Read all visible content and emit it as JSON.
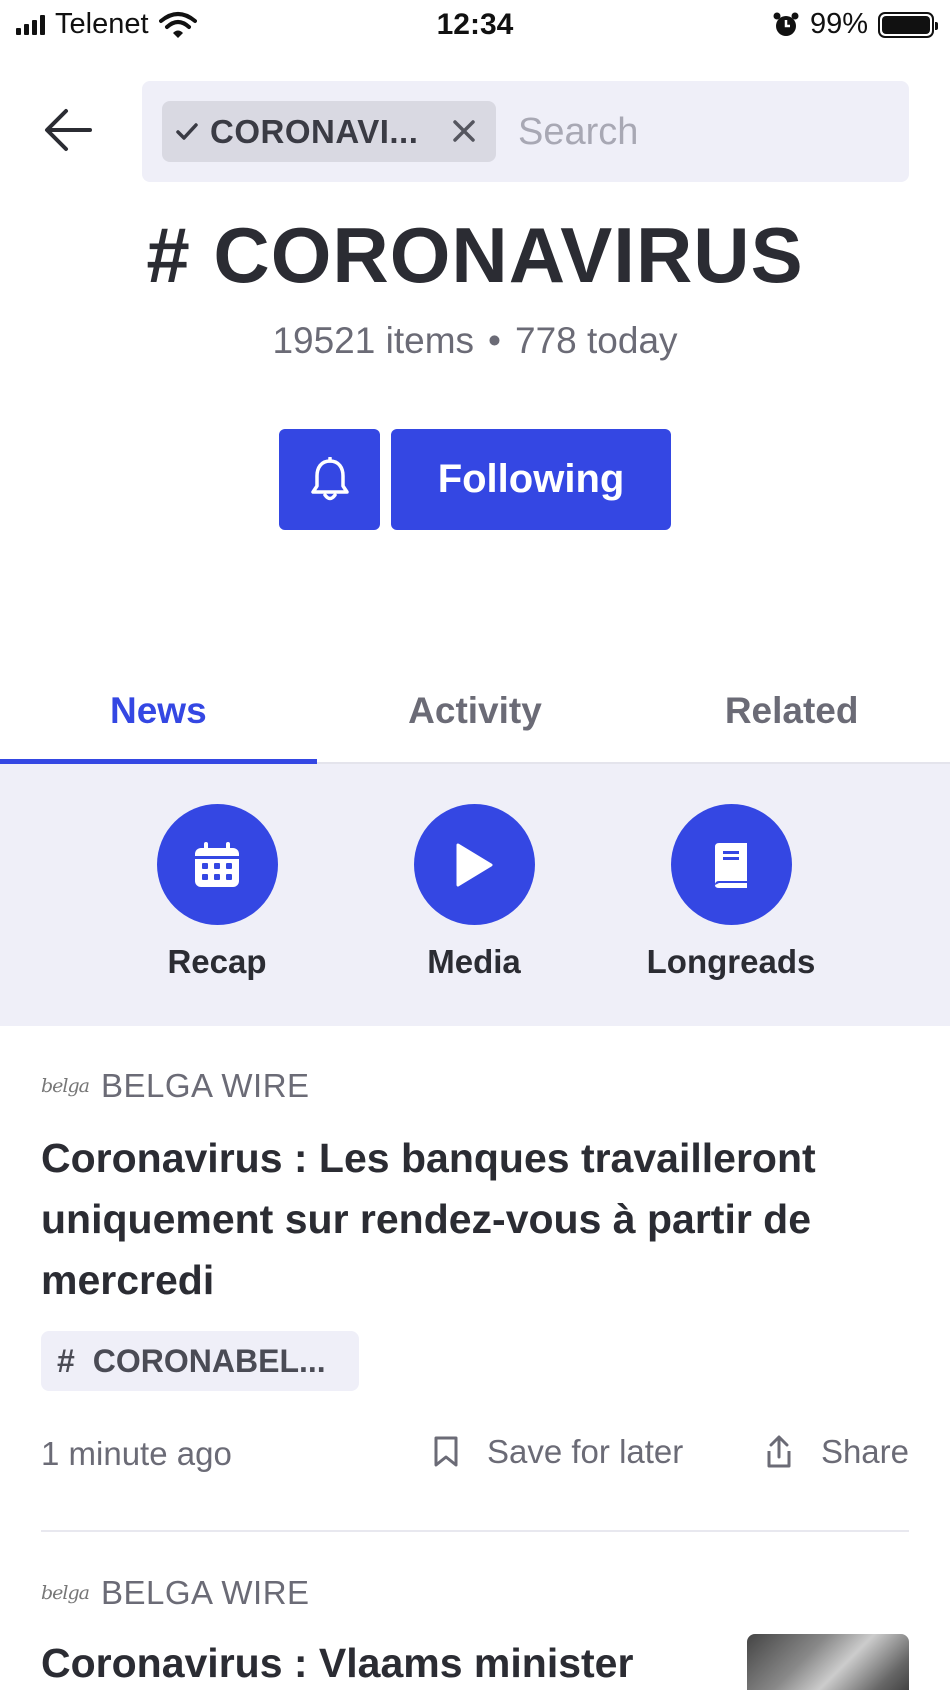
{
  "status_bar": {
    "carrier": "Telenet",
    "time": "12:34",
    "battery": "99%"
  },
  "search": {
    "chip_label": "CORONAVI...",
    "placeholder": "Search"
  },
  "topic": {
    "title": "# CORONAVIRUS",
    "items": "19521 items",
    "separator": "•",
    "today": "778 today",
    "follow_label": "Following"
  },
  "tabs": [
    {
      "label": "News",
      "active": true
    },
    {
      "label": "Activity",
      "active": false
    },
    {
      "label": "Related",
      "active": false
    }
  ],
  "quick_links": [
    {
      "label": "Recap",
      "icon": "calendar-icon"
    },
    {
      "label": "Media",
      "icon": "play-icon"
    },
    {
      "label": "Longreads",
      "icon": "book-icon"
    }
  ],
  "articles": [
    {
      "logo": "belga",
      "source": "BELGA WIRE",
      "headline": "Coronavirus : Les banques travailleront uniquement sur rendez-vous à partir de mercredi",
      "tag": "CORONABEL...",
      "time": "1 minute ago",
      "save_label": "Save for later",
      "share_label": "Share"
    },
    {
      "logo": "belga",
      "source": "BELGA WIRE",
      "headline": "Coronavirus : Vlaams minister"
    }
  ],
  "colors": {
    "accent": "#3447e3",
    "panel": "#efeff8",
    "text": "#2b2c33",
    "muted": "#6b6b76"
  }
}
